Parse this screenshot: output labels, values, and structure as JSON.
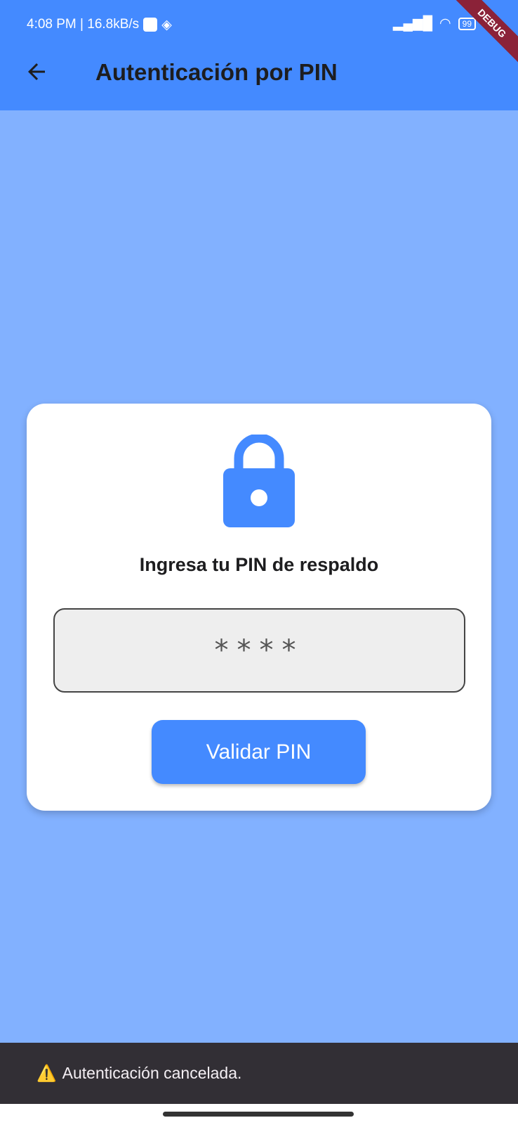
{
  "status_bar": {
    "time_speed": "4:08 PM | 16.8kB/s",
    "battery": "99",
    "debug_banner": "DEBUG"
  },
  "app_bar": {
    "title": "Autenticación por PIN"
  },
  "card": {
    "heading": "Ingresa tu PIN de respaldo",
    "pin_value": "****",
    "button_label": "Validar PIN"
  },
  "snackbar": {
    "icon": "⚠️",
    "message": "Autenticación cancelada."
  },
  "colors": {
    "primary": "#448aff",
    "background": "#82b1ff",
    "snackbar": "#322f35"
  }
}
